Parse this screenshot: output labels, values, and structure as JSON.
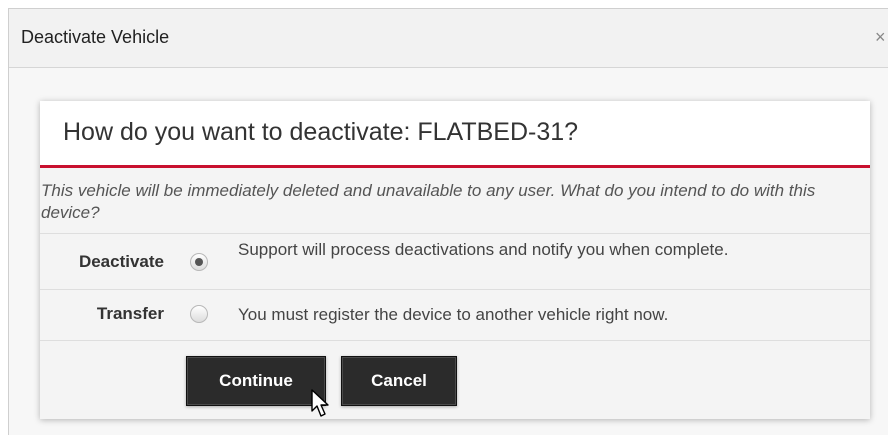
{
  "dialog": {
    "title": "Deactivate Vehicle",
    "close_glyph": "×"
  },
  "panel": {
    "question": "How do you want to deactivate: FLATBED-31?",
    "info": "This vehicle will be immediately deleted and unavailable to any user. What do you intend to do with this device?",
    "accent_color": "#c8102e",
    "options": [
      {
        "label": "Deactivate",
        "description": "Support will process deactivations and notify you when complete.",
        "selected": true
      },
      {
        "label": "Transfer",
        "description": "You must register the device to another vehicle right now.",
        "selected": false
      }
    ]
  },
  "buttons": {
    "continue_label": "Continue",
    "cancel_label": "Cancel"
  },
  "icons": {
    "close": "close-icon",
    "cursor": "mouse-cursor-icon"
  }
}
